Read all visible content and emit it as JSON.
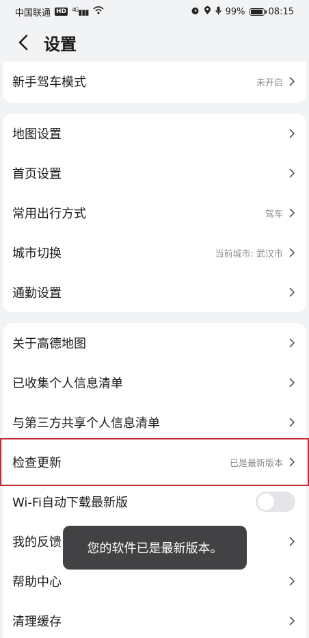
{
  "status_bar": {
    "carrier": "中国联通",
    "hd": "HD",
    "network": "4G",
    "battery": "99%",
    "time": "08:15"
  },
  "header": {
    "title": "设置"
  },
  "group1": [
    {
      "label": "新手驾车模式",
      "value": "未开启"
    }
  ],
  "group2": [
    {
      "label": "地图设置",
      "value": ""
    },
    {
      "label": "首页设置",
      "value": ""
    },
    {
      "label": "常用出行方式",
      "value": "驾车"
    },
    {
      "label": "城市切换",
      "value": "当前城市: 武汉市"
    },
    {
      "label": "通勤设置",
      "value": ""
    }
  ],
  "group3": [
    {
      "label": "关于高德地图",
      "value": ""
    },
    {
      "label": "已收集个人信息清单",
      "value": ""
    },
    {
      "label": "与第三方共享个人信息清单",
      "value": ""
    },
    {
      "label": "检查更新",
      "value": "已是最新版本"
    },
    {
      "label": "Wi-Fi自动下载最新版",
      "toggle": false
    },
    {
      "label": "我的反馈",
      "value": ""
    },
    {
      "label": "帮助中心",
      "value": ""
    },
    {
      "label": "清理缓存",
      "value": ""
    }
  ],
  "toast": {
    "message": "您的软件已是最新版本。"
  },
  "colors": {
    "highlight_border": "#c22a35",
    "card_bg": "#ffffff",
    "page_bg": "#f1f3f5"
  }
}
